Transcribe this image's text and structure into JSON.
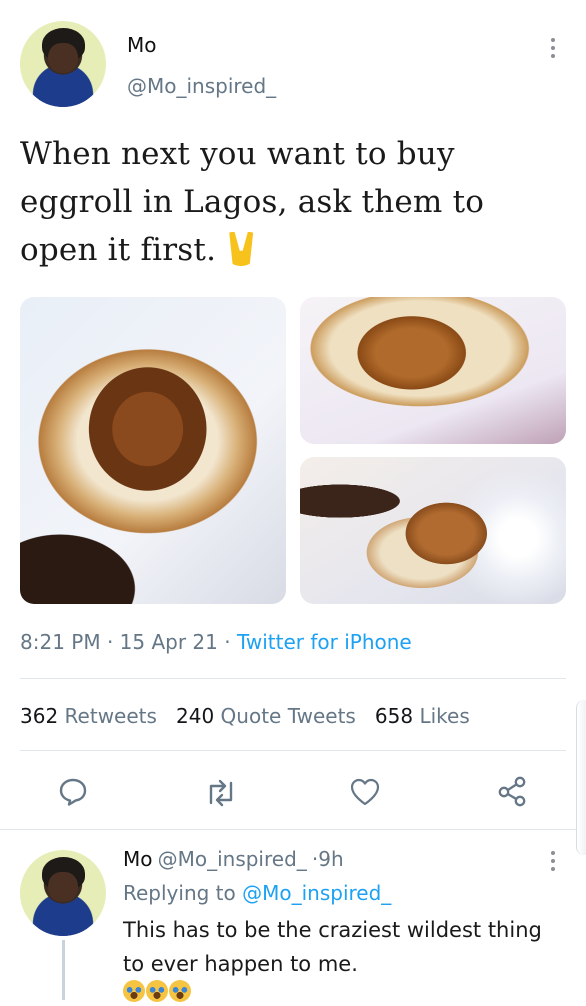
{
  "tweet": {
    "author_name": "Mo",
    "author_handle": "@Mo_inspired_",
    "text": "When next you want to buy eggroll in Lagos, ask them to open it first.",
    "emoji": "victory-hand",
    "time": "8:21 PM",
    "date": "15 Apr 21",
    "source": "Twitter for iPhone",
    "stats": {
      "retweets_count": "362",
      "retweets_label": "Retweets",
      "quote_count": "240",
      "quote_label": "Quote Tweets",
      "likes_count": "658",
      "likes_label": "Likes"
    },
    "actions": [
      "reply-icon",
      "retweet-icon",
      "like-icon",
      "share-icon"
    ]
  },
  "reply": {
    "author_name": "Mo",
    "author_handle": "@Mo_inspired_",
    "time_ago": "9h",
    "replying_prefix": "Replying to",
    "replying_to": "@Mo_inspired_",
    "text": "This has to be the craziest wildest thing to ever happen to me."
  },
  "colors": {
    "link": "#1da1f2",
    "secondary_text": "#657786",
    "divider": "#e1e8ed"
  }
}
